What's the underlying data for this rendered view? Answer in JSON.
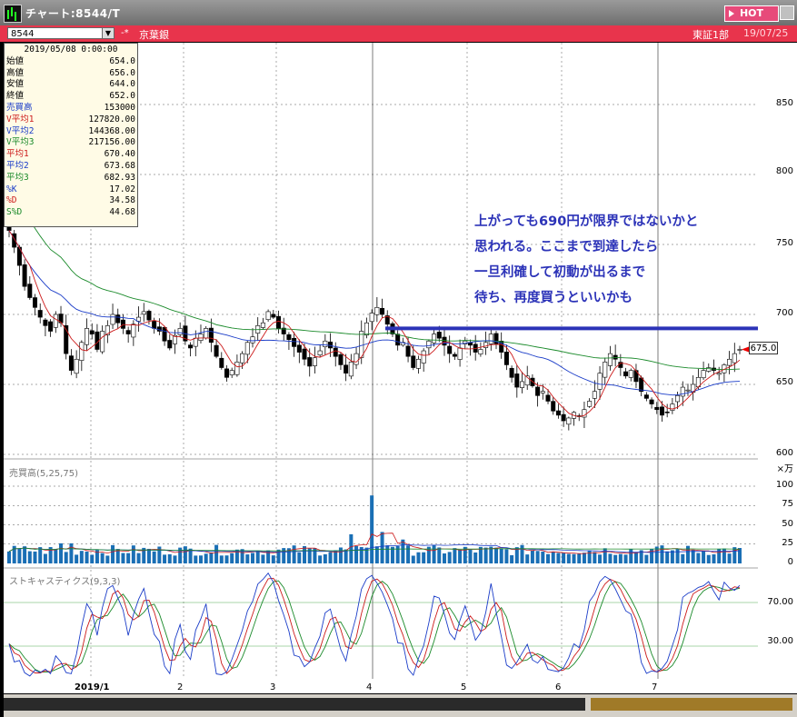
{
  "window": {
    "title": "チャート:8544/T",
    "hot_label": "HOT"
  },
  "toolbar": {
    "symbol": "8544",
    "arrow": "-*",
    "company": "京葉銀",
    "market": "東証1部",
    "date": "19/07/25"
  },
  "info": {
    "datetime": "2019/05/08 0:00:00",
    "rows": [
      {
        "label": "始値",
        "value": "654.0",
        "color": "#000000"
      },
      {
        "label": "高値",
        "value": "656.0",
        "color": "#000000"
      },
      {
        "label": "安値",
        "value": "644.0",
        "color": "#000000"
      },
      {
        "label": "終値",
        "value": "652.0",
        "color": "#000000"
      },
      {
        "label": "売買高",
        "value": "153000",
        "color": "#1a3cc8"
      },
      {
        "label": "V平均1",
        "value": "127820.00",
        "color": "#cc1a1a"
      },
      {
        "label": "V平均2",
        "value": "144368.00",
        "color": "#1a3cc8"
      },
      {
        "label": "V平均3",
        "value": "217156.00",
        "color": "#1a8a2a"
      },
      {
        "label": "平均1",
        "value": "670.40",
        "color": "#cc1a1a"
      },
      {
        "label": "平均2",
        "value": "673.68",
        "color": "#1a3cc8"
      },
      {
        "label": "平均3",
        "value": "682.93",
        "color": "#1a8a2a"
      },
      {
        "label": "%K",
        "value": "17.02",
        "color": "#1a3cc8"
      },
      {
        "label": "%D",
        "value": "34.58",
        "color": "#cc1a1a"
      },
      {
        "label": "S%D",
        "value": "44.68",
        "color": "#1a8a2a"
      }
    ]
  },
  "comment": {
    "lines": [
      "上がっても690円が限界ではないかと",
      "思われる。ここまで到達したら",
      "一旦利確して初動が出るまで",
      "待ち、再度買うといいかも"
    ]
  },
  "price_axis": {
    "labels": [
      "850",
      "800",
      "750",
      "700",
      "650",
      "600"
    ]
  },
  "volume_axis": {
    "unit": "×万",
    "labels": [
      "100",
      "75",
      "50",
      "25",
      "0"
    ]
  },
  "stoch_axis": {
    "labels": [
      "70.00",
      "30.00"
    ]
  },
  "x_axis": {
    "labels": [
      "2019/1",
      "2",
      "3",
      "4",
      "5",
      "6",
      "7"
    ]
  },
  "panels": {
    "volume_title": "売買高(5,25,75)",
    "stoch_title": "ストキャスティクス(9,3,3)"
  },
  "current_price": "675.0",
  "colors": {
    "up": "#1a3cc8",
    "down": "#cc1a1a",
    "ma1": "#cc1a1a",
    "ma2": "#1a3cc8",
    "ma3": "#1a8a2a",
    "annotation": "#2c33b8",
    "bar": "#1a6fb5"
  },
  "chart_data": {
    "type": "candlestick",
    "annotation_level": 690,
    "price_range": [
      595,
      870
    ],
    "closes": [
      760,
      748,
      735,
      720,
      712,
      705,
      698,
      692,
      688,
      700,
      694,
      672,
      660,
      668,
      680,
      690,
      686,
      675,
      688,
      692,
      700,
      694,
      690,
      686,
      693,
      698,
      702,
      696,
      690,
      688,
      681,
      676,
      685,
      690,
      681,
      676,
      683,
      686,
      690,
      680,
      670,
      662,
      655,
      660,
      666,
      672,
      680,
      684,
      692,
      694,
      702,
      698,
      690,
      686,
      682,
      677,
      673,
      668,
      663,
      669,
      674,
      681,
      676,
      670,
      664,
      658,
      666,
      672,
      688,
      694,
      701,
      705,
      700,
      693,
      686,
      678,
      680,
      670,
      662,
      668,
      674,
      681,
      686,
      683,
      678,
      672,
      670,
      676,
      681,
      678,
      673,
      675,
      680,
      686,
      679,
      673,
      664,
      655,
      648,
      652,
      656,
      649,
      642,
      645,
      638,
      631,
      628,
      624,
      626,
      630,
      627,
      632,
      638,
      645,
      658,
      666,
      672,
      668,
      662,
      656,
      660,
      652,
      645,
      640,
      636,
      632,
      628,
      630,
      636,
      642,
      648,
      646,
      650,
      655,
      660,
      662,
      660,
      658,
      664,
      668,
      672,
      675
    ]
  }
}
